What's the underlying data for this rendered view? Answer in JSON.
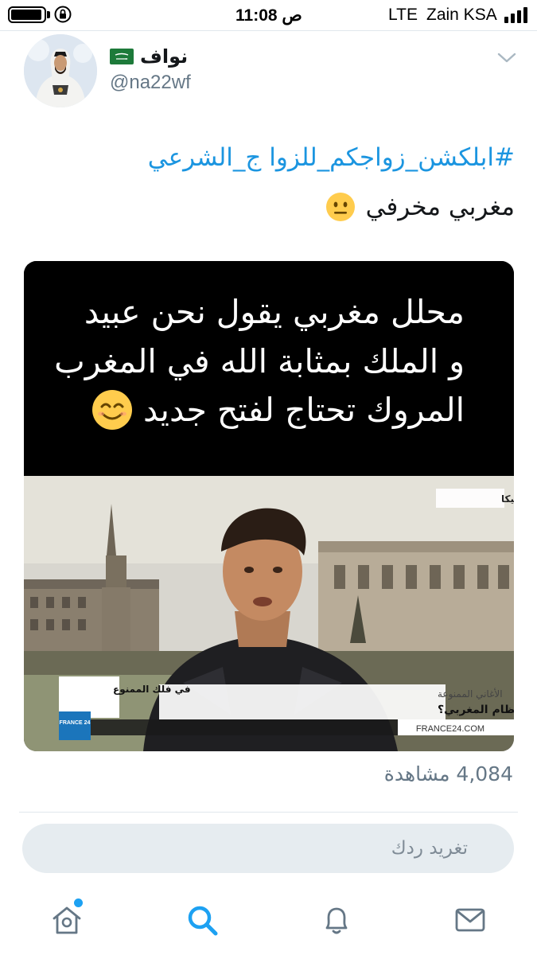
{
  "status_bar": {
    "time": "11:08 ص",
    "network": "LTE",
    "carrier": "Zain KSA",
    "battery_level": 0.95
  },
  "tweet": {
    "display_name": "نواف",
    "username": "@na22wf",
    "hashtag": "#ابلكشن_زواجكم_للزوا ج_الشرعي",
    "text": "مغربي مخرفي",
    "media_caption": [
      "محلل مغربي يقول نحن عبيد",
      "و الملك بمثابة الله في المغرب",
      "المروك تحتاج لفتح جديد"
    ],
    "video_overlay": {
      "location_tag": "بروكسل، بلجيكا",
      "ticker_title": "الأغاني الممنوعة",
      "ticker_text": "ماذا يقول \"الحاقد\" للنظام المغربي؟",
      "show_name": "في فلك الممنوع",
      "channel_logo": "FRANCE 24",
      "channel_url": "FRANCE24.COM"
    },
    "view_count": "4,084",
    "view_label": "مشاهدة"
  },
  "reply": {
    "placeholder": "تغريد ردك"
  },
  "tab_bar": {
    "items": [
      {
        "name": "home",
        "icon": "home-icon",
        "badge": true
      },
      {
        "name": "search",
        "icon": "search-icon",
        "active": true
      },
      {
        "name": "notifications",
        "icon": "bell-icon"
      },
      {
        "name": "messages",
        "icon": "envelope-icon"
      }
    ]
  },
  "colors": {
    "accent": "#1da1f2",
    "link": "#1b95e0",
    "secondary_text": "#657786",
    "reply_bg": "#e6ecf0"
  }
}
